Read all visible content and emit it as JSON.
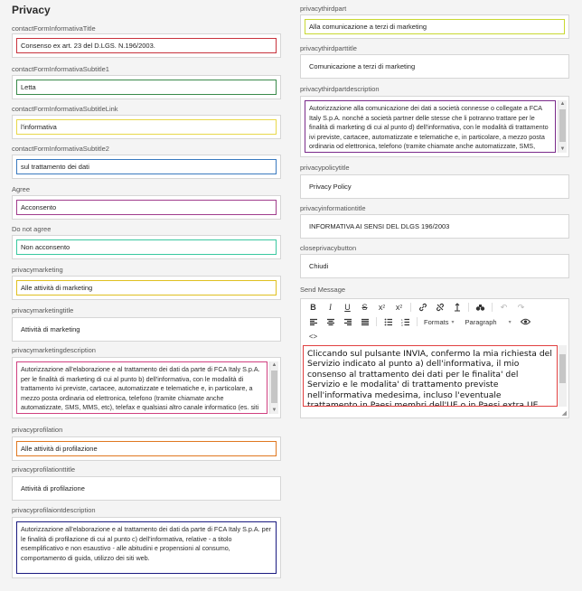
{
  "page": {
    "title": "Privacy"
  },
  "left": {
    "f1": {
      "label": "contactFormInformativaTitle",
      "value": "Consenso ex art. 23 del D.LGS. N.196/2003."
    },
    "f2": {
      "label": "contactFormInformativaSubtitle1",
      "value": "Letta"
    },
    "f3": {
      "label": "contactFormInformativaSubtitleLink",
      "value": "l'informativa"
    },
    "f4": {
      "label": "contactFormInformativaSubtitle2",
      "value": "sul trattamento dei dati"
    },
    "f5": {
      "label": "Agree",
      "value": "Acconsento"
    },
    "f6": {
      "label": "Do not agree",
      "value": "Non acconsento"
    },
    "f7": {
      "label": "privacymarketing",
      "value": "Alle attività di marketing"
    },
    "f8": {
      "label": "privacymarketingtitle",
      "value": "Attività di marketing"
    },
    "f9": {
      "label": "privacymarketingdescription",
      "value": "Autorizzazione all'elaborazione e al trattamento dei dati da parte di FCA Italy S.p.A. per le finalità di marketing di cui al punto b) dell'informativa, con le modalità di trattamento ivi previste, cartacee, automatizzate e telematiche e, in particolare, a mezzo posta ordinaria od elettronica, telefono (tramite chiamate anche automatizzate, SMS, MMS, etc), telefax e qualsiasi altro canale informatico (es. siti web, mobile app)"
    },
    "f10": {
      "label": "privacyprofilation",
      "value": "Alle attività di profilazione"
    },
    "f11": {
      "label": "privacyprofilationttitle",
      "value": "Attività di profilazione"
    },
    "f12": {
      "label": "privacyprofilaiontdescription",
      "value": "Autorizzazione all'elaborazione e al trattamento dei dati da parte di FCA Italy S.p.A. per le finalità di profilazione di cui al punto c) dell'informativa, relative - a titolo esemplificativo e non esaustivo - alle abitudini e propensioni al consumo, comportamento di guida, utilizzo dei siti web."
    }
  },
  "right": {
    "r1": {
      "label": "privacythirdpart",
      "value": "Alla comunicazione a terzi di marketing"
    },
    "r2": {
      "label": "privacythirdparttitle",
      "value": "Comunicazione a terzi di marketing"
    },
    "r3": {
      "label": "privacythirdpartdescription",
      "value": "Autorizzazione alla comunicazione dei dati a società connesse o collegate a FCA Italy S.p.A. nonché a società partner delle stesse che li potranno trattare per le finalità di marketing di cui al punto d) dell'informativa, con le modalità di trattamento ivi previste, cartacee, automatizzate e telematiche e, in particolare, a mezzo posta ordinaria od elettronica, telefono (tramite chiamate anche automatizzate, SMS, MMS, etc), telefax e qualsiasi altro canale informatico (es. siti web, mobile app)"
    },
    "r4": {
      "label": "privacypolicytitle",
      "value": "Privacy Policy"
    },
    "r5": {
      "label": "privacyinformationtitle",
      "value": "INFORMATIVA AI SENSI DEL DLGS 196/2003"
    },
    "r6": {
      "label": "closeprivacybutton",
      "value": "Chiudi"
    },
    "editor": {
      "label": "Send Message",
      "formats_label": "Formats",
      "paragraph_label": "Paragraph",
      "source_label": "<>",
      "content": "Cliccando sul pulsante INVIA, confermo la mia richiesta del Servizio indicato al punto a) dell'informativa, il mio consenso al trattamento dei dati per le finalita' del Servizio e le modalita' di trattamento previste nell'informativa medesima, incluso l'eventuale trattamento in Paesi membri dell'UE o in Paesi extra UE."
    }
  },
  "colors": {
    "f1": "#c8323c",
    "f2": "#3a8a4a",
    "f3": "#e8d84a",
    "f4": "#3a7abf",
    "f5": "#a03c8c",
    "f6": "#3ac8a0",
    "f7": "#e0c020",
    "f9": "#d04080",
    "f10": "#e07820",
    "f12": "#1a1a80",
    "r1": "#c8d830",
    "r3": "#7a2a8a"
  }
}
